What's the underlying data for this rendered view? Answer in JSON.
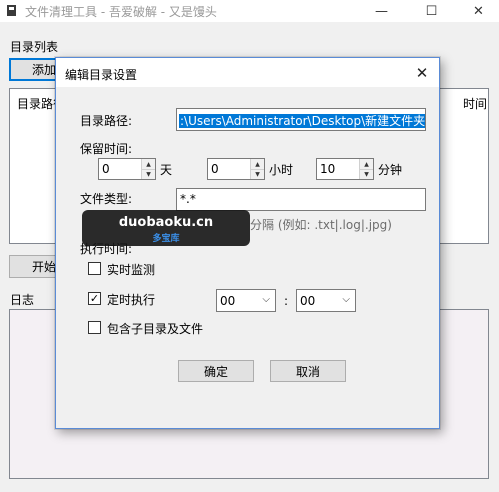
{
  "window": {
    "title": "文件清理工具 - 吾爱破解 - 又是馒头",
    "minimize_glyph": "—",
    "maximize_glyph": "☐",
    "close_glyph": "✕"
  },
  "main": {
    "dir_list_label": "目录列表",
    "add_button": "添加",
    "list_header_left": "目录路径",
    "list_header_right": "时间",
    "start_button": "开始",
    "log_label": "日志"
  },
  "dialog": {
    "title": "编辑目录设置",
    "close_glyph": "✕",
    "path_label": "目录路径:",
    "path_value": ":\\Users\\Administrator\\Desktop\\新建文件夹",
    "retention_label": "保留时间:",
    "days_value": "0",
    "days_unit": "天",
    "hours_value": "0",
    "hours_unit": "小时",
    "minutes_value": "10",
    "minutes_unit": "分钟",
    "filetype_label": "文件类型:",
    "filetype_value": "*.*",
    "filetype_hint": "分隔 (例如: .txt|.log|.jpg)",
    "exec_label": "执行时间:",
    "realtime_label": "实时监测",
    "realtime_checked": false,
    "scheduled_label": "定时执行",
    "scheduled_checked": true,
    "hour_select": "00",
    "time_sep": ":",
    "minute_select": "00",
    "include_sub_label": "包含子目录及文件",
    "include_sub_checked": false,
    "ok_button": "确定",
    "cancel_button": "取消"
  },
  "watermark": {
    "main": "duobaoku.cn",
    "sub": "多宝库"
  },
  "icons": {
    "check": "✓",
    "dropdown": "⌵",
    "spin_up": "▲",
    "spin_down": "▼"
  },
  "colors": {
    "accent": "#0078d7",
    "dialog_border": "#5a8bd6"
  }
}
